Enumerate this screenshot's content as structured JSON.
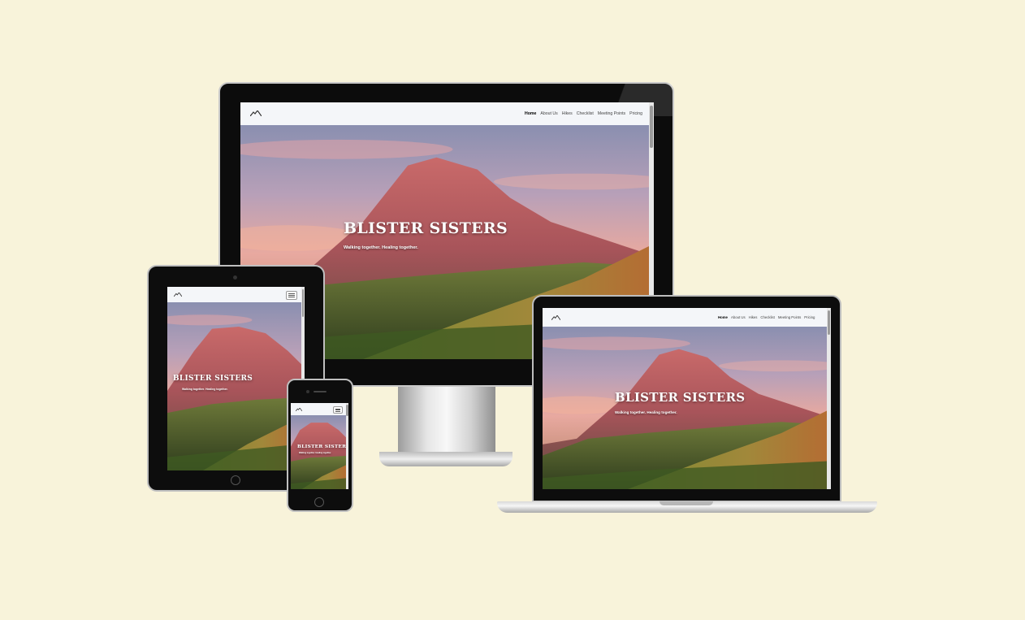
{
  "brand": {
    "title": "BLISTER SISTERS",
    "tagline": "Walking together. Healing together."
  },
  "nav": {
    "items": [
      "Home",
      "About Us",
      "Hikes",
      "Checklist",
      "Meeting Points",
      "Pricing"
    ],
    "active": "Home"
  },
  "icons": {
    "logo": "mountain-logo-icon",
    "menu": "hamburger-menu-icon"
  },
  "colors": {
    "background": "#f8f3da",
    "bezel": "#0d0d0d",
    "navbar": "#f4f6f9"
  }
}
